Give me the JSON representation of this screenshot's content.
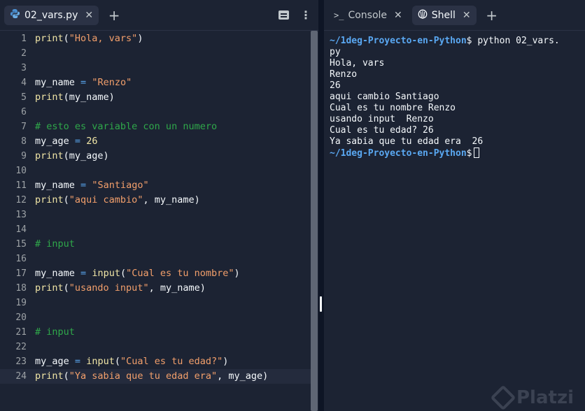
{
  "editor": {
    "tab_label": "02_vars.py",
    "code_lines": [
      {
        "n": "1",
        "tokens": [
          [
            "fn",
            "print"
          ],
          [
            "var",
            "("
          ],
          [
            "str",
            "\"Hola, vars\""
          ],
          [
            "var",
            ")"
          ]
        ]
      },
      {
        "n": "2",
        "tokens": []
      },
      {
        "n": "3",
        "tokens": []
      },
      {
        "n": "4",
        "tokens": [
          [
            "var",
            "my_name "
          ],
          [
            "op",
            "="
          ],
          [
            "var",
            " "
          ],
          [
            "str",
            "\"Renzo\""
          ]
        ]
      },
      {
        "n": "5",
        "tokens": [
          [
            "fn",
            "print"
          ],
          [
            "var",
            "(my_name)"
          ]
        ]
      },
      {
        "n": "6",
        "tokens": []
      },
      {
        "n": "7",
        "tokens": [
          [
            "com",
            "# esto es variable con un numero"
          ]
        ]
      },
      {
        "n": "8",
        "tokens": [
          [
            "var",
            "my_age "
          ],
          [
            "op",
            "="
          ],
          [
            "var",
            " "
          ],
          [
            "num",
            "26"
          ]
        ]
      },
      {
        "n": "9",
        "tokens": [
          [
            "fn",
            "print"
          ],
          [
            "var",
            "(my_age)"
          ]
        ]
      },
      {
        "n": "10",
        "tokens": []
      },
      {
        "n": "11",
        "tokens": [
          [
            "var",
            "my_name "
          ],
          [
            "op",
            "="
          ],
          [
            "var",
            " "
          ],
          [
            "str",
            "\"Santiago\""
          ]
        ]
      },
      {
        "n": "12",
        "tokens": [
          [
            "fn",
            "print"
          ],
          [
            "var",
            "("
          ],
          [
            "str",
            "\"aqui cambio\""
          ],
          [
            "var",
            ", my_name)"
          ]
        ]
      },
      {
        "n": "13",
        "tokens": []
      },
      {
        "n": "14",
        "tokens": []
      },
      {
        "n": "15",
        "tokens": [
          [
            "com",
            "# input"
          ]
        ]
      },
      {
        "n": "16",
        "tokens": []
      },
      {
        "n": "17",
        "tokens": [
          [
            "var",
            "my_name "
          ],
          [
            "op",
            "="
          ],
          [
            "var",
            " "
          ],
          [
            "fn",
            "input"
          ],
          [
            "var",
            "("
          ],
          [
            "str",
            "\"Cual es tu nombre\""
          ],
          [
            "var",
            ")"
          ]
        ]
      },
      {
        "n": "18",
        "tokens": [
          [
            "fn",
            "print"
          ],
          [
            "var",
            "("
          ],
          [
            "str",
            "\"usando input\""
          ],
          [
            "var",
            ", my_name)"
          ]
        ]
      },
      {
        "n": "19",
        "tokens": []
      },
      {
        "n": "20",
        "tokens": []
      },
      {
        "n": "21",
        "tokens": [
          [
            "com",
            "# input"
          ]
        ]
      },
      {
        "n": "22",
        "tokens": []
      },
      {
        "n": "23",
        "tokens": [
          [
            "var",
            "my_age "
          ],
          [
            "op",
            "="
          ],
          [
            "var",
            " "
          ],
          [
            "fn",
            "input"
          ],
          [
            "var",
            "("
          ],
          [
            "str",
            "\"Cual es tu edad?\""
          ],
          [
            "var",
            ")"
          ]
        ]
      },
      {
        "n": "24",
        "tokens": [
          [
            "fn",
            "print"
          ],
          [
            "var",
            "("
          ],
          [
            "str",
            "\"Ya sabia que tu edad era\""
          ],
          [
            "var",
            ", my_age)"
          ]
        ]
      }
    ],
    "active_line": 24
  },
  "console": {
    "tabs": [
      {
        "label": "Console",
        "icon": "terminal-icon"
      },
      {
        "label": "Shell",
        "icon": "shell-icon"
      }
    ],
    "active_tab": "Shell",
    "prompt": "~/1deg-Proyecto-en-Python",
    "command": "python 02_vars.",
    "command_wrap": "py",
    "output": [
      "Hola, vars",
      "Renzo",
      "26",
      "aqui cambio Santiago",
      "Cual es tu nombre Renzo",
      "usando input  Renzo",
      "Cual es tu edad? 26",
      "Ya sabia que tu edad era  26"
    ],
    "prompt_symbol": "$",
    "watermark": "Platzi"
  },
  "colors": {
    "background": "#1c2333",
    "prompt": "#5aa8f2",
    "string": "#f29f6b",
    "function": "#f0e5a6",
    "comment": "#2fa84a"
  }
}
